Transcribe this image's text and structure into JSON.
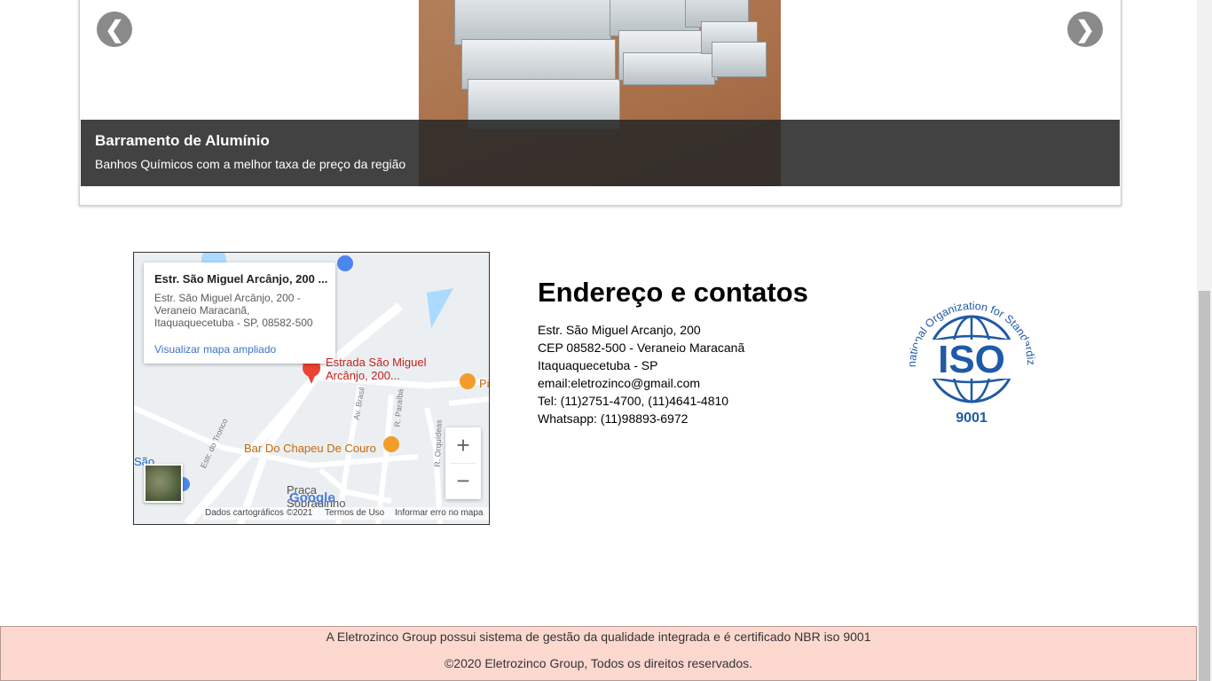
{
  "carousel": {
    "prev_icon": "chevron-left-icon",
    "next_icon": "chevron-right-icon",
    "prev_glyph": "❮",
    "next_glyph": "❯",
    "slide": {
      "title": "Barramento de Alumínio",
      "description": "Banhos Químicos com a melhor taxa de preço da região"
    }
  },
  "map": {
    "info_window": {
      "name": "Estr. São Miguel Arcânjo, 200 ...",
      "address": "Estr. São Miguel Arcânjo, 200 - Veraneio Maracanã, Itaquaquecetuba - SP, 08582-500",
      "link": "Visualizar mapa ampliado"
    },
    "labels": {
      "pin_label_1": "Estrada São Miguel",
      "pin_label_2": "Arcânjo, 200...",
      "bar": "Bar Do Chapeu De Couro",
      "praca_1": "Praça",
      "praca_2": "Sobradinho",
      "pi": "Pi",
      "sao": "São"
    },
    "streets": {
      "troco": "Estr. do Tronco",
      "brasil": "Av. Brasil",
      "paraiba": "R. Paraíba",
      "orquideas": "R. Orquídeas"
    },
    "zoom_in": "+",
    "zoom_out": "−",
    "attribution": {
      "data": "Dados cartográficos ©2021",
      "terms": "Termos de Uso",
      "report": "Informar erro no mapa"
    },
    "logo": "Google"
  },
  "contact": {
    "title": "Endereço e contatos",
    "lines": [
      "Estr. São Miguel Arcanjo, 200",
      "CEP 08582-500 - Veraneio Maracanã",
      "Itaquaquecetuba - SP",
      "email:eletrozinco@gmail.com",
      "Tel: (11)2751-4700, (11)4641-4810",
      "Whatsapp: (11)98893-6972"
    ]
  },
  "iso_logo": {
    "ring_text": "International Organization for Standardization",
    "mark": "ISO",
    "number": "9001",
    "color": "#1f5aa6"
  },
  "footer": {
    "line1": "A Eletrozinco Group possui sistema de gestão da qualidade integrada e é certificado NBR iso 9001",
    "line2": "©2020 Eletrozinco Group, Todos os direitos reservados."
  }
}
